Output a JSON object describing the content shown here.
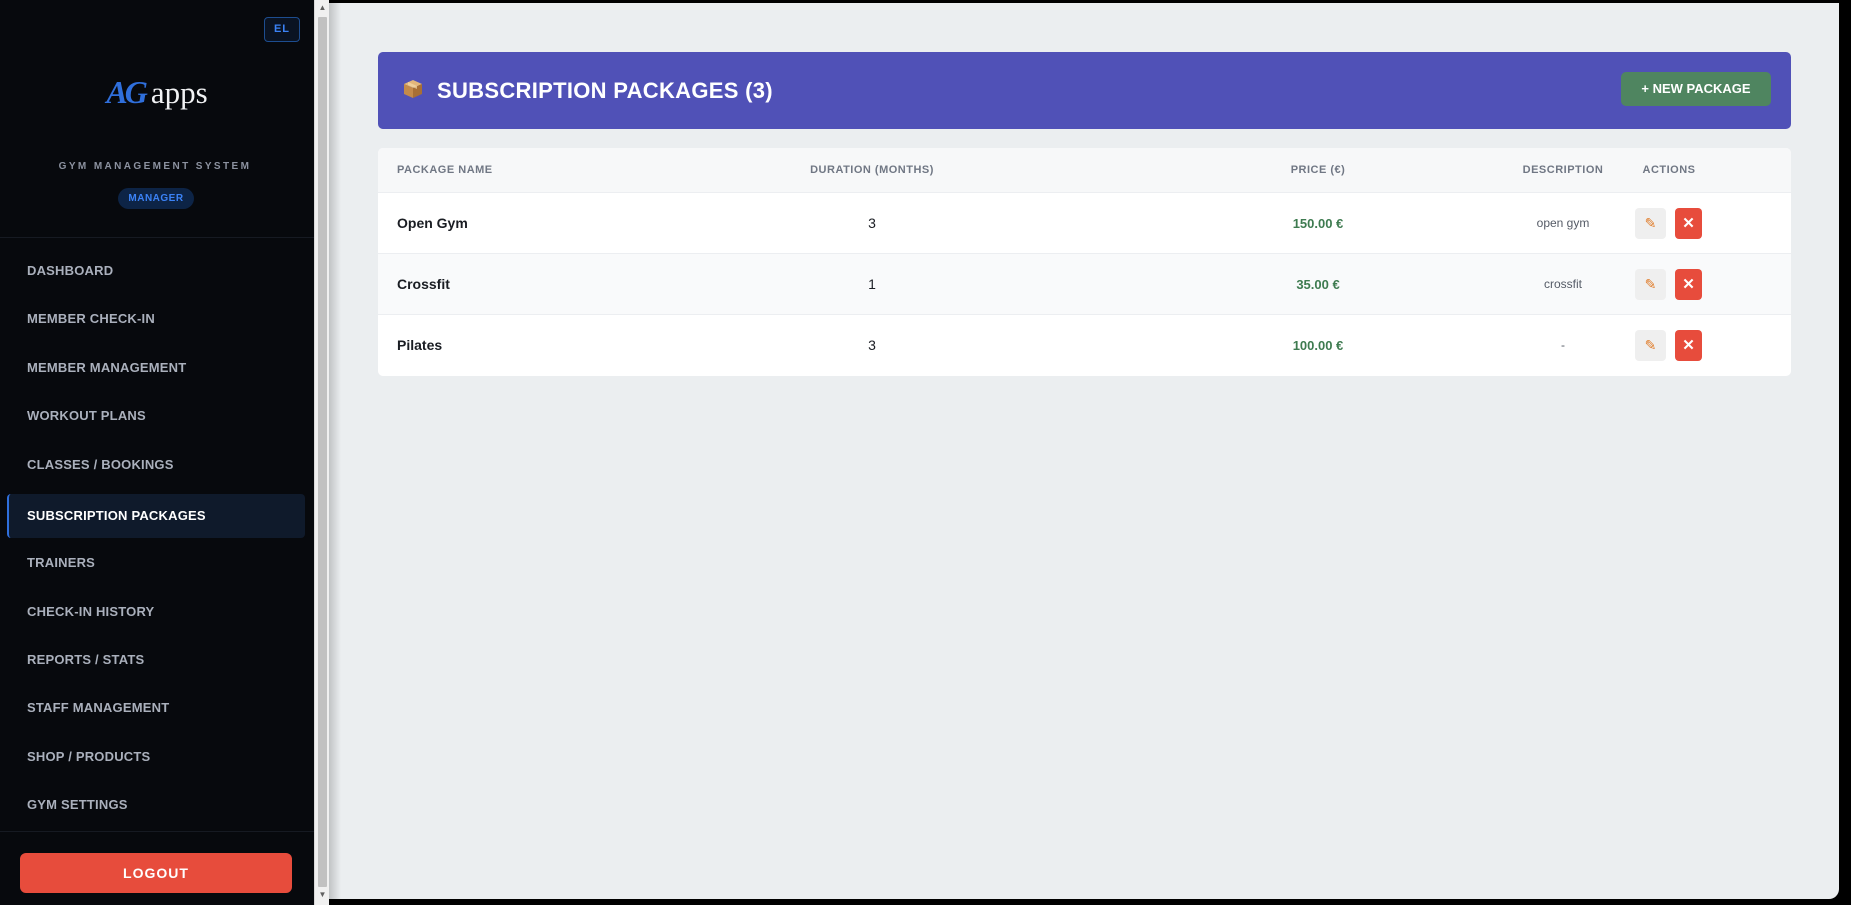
{
  "sidebar": {
    "lang_button": "EL",
    "logo_mark": "AG",
    "logo_text": "apps",
    "system_name": "GYM MANAGEMENT SYSTEM",
    "role_badge": "MANAGER",
    "nav_items": [
      {
        "label": "DASHBOARD",
        "active": false
      },
      {
        "label": "MEMBER CHECK-IN",
        "active": false
      },
      {
        "label": "MEMBER MANAGEMENT",
        "active": false
      },
      {
        "label": "WORKOUT PLANS",
        "active": false
      },
      {
        "label": "CLASSES / BOOKINGS",
        "active": false
      },
      {
        "label": "SUBSCRIPTION PACKAGES",
        "active": true
      },
      {
        "label": "TRAINERS",
        "active": false
      },
      {
        "label": "CHECK-IN HISTORY",
        "active": false
      },
      {
        "label": "REPORTS / STATS",
        "active": false
      },
      {
        "label": "STAFF MANAGEMENT",
        "active": false
      },
      {
        "label": "SHOP / PRODUCTS",
        "active": false
      },
      {
        "label": "GYM SETTINGS",
        "active": false
      }
    ],
    "logout_label": "LOGOUT"
  },
  "header": {
    "icon": "package-icon",
    "title": "SUBSCRIPTION PACKAGES (3)",
    "new_button_label": "+ NEW PACKAGE"
  },
  "table": {
    "columns": [
      "PACKAGE NAME",
      "DURATION (MONTHS)",
      "PRICE (€)",
      "DESCRIPTION",
      "ACTIONS"
    ],
    "rows": [
      {
        "name": "Open Gym",
        "duration": "3",
        "price": "150.00 €",
        "description": "open gym"
      },
      {
        "name": "Crossfit",
        "duration": "1",
        "price": "35.00 €",
        "description": "crossfit"
      },
      {
        "name": "Pilates",
        "duration": "3",
        "price": "100.00 €",
        "description": "-"
      }
    ]
  },
  "colors": {
    "header_bg": "#5051b7",
    "new_button": "#4f8560",
    "delete_button": "#e74c3c",
    "edit_icon": "#e07b28",
    "accent": "#2f6fdc"
  }
}
